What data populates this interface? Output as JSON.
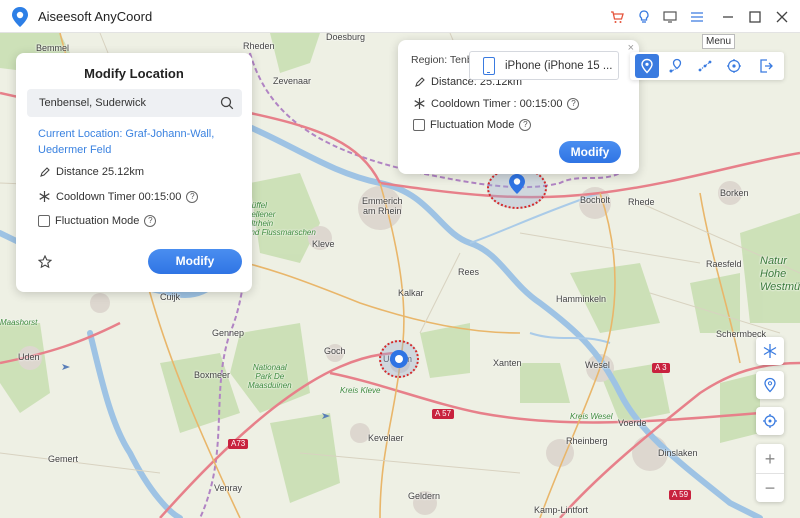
{
  "app": {
    "title": "Aiseesoft AnyCoord",
    "menu_tooltip": "Menu",
    "icons": [
      "cart-icon",
      "hint-icon",
      "screen-icon",
      "menu-icon",
      "minimize-icon",
      "maximize-icon",
      "close-icon"
    ]
  },
  "modify_panel": {
    "title": "Modify Location",
    "search_value": "Tenbensel,  Suderwick",
    "current_location": "Current Location: Graf-Johann-Wall, Uedermer Feld",
    "distance": "Distance 25.12km",
    "cooldown": "Cooldown Timer 00:15:00",
    "fluctuation": "Fluctuation Mode",
    "button": "Modify"
  },
  "popup": {
    "region": "Region: Tenbensel,  Suderwick",
    "distance": "Distance: 25.12km",
    "cooldown": "Cooldown Timer : 00:15:00",
    "fluctuation": "Fluctuation Mode",
    "button": "Modify",
    "close": "×"
  },
  "device": {
    "name": "iPhone (iPhone 15 ..."
  },
  "modes": [
    "modify-location",
    "one-stop-mode",
    "multi-stop-mode",
    "joystick-mode",
    "exit"
  ],
  "side_controls": {
    "zoom_in": "+",
    "zoom_out": "−"
  },
  "map": {
    "places": [
      {
        "name": "Doesburg"
      },
      {
        "name": "Rheden"
      },
      {
        "name": "Bemmel"
      },
      {
        "name": "Zevenaar"
      },
      {
        "name": "Emmerich\nam Rhein"
      },
      {
        "name": "Kleve"
      },
      {
        "name": "Bocholt"
      },
      {
        "name": "Rhede"
      },
      {
        "name": "Borken"
      },
      {
        "name": "Cuijk"
      },
      {
        "name": "Kalkar"
      },
      {
        "name": "Rees"
      },
      {
        "name": "Hamminkeln"
      },
      {
        "name": "Raesfeld"
      },
      {
        "name": "Gennep"
      },
      {
        "name": "Goch"
      },
      {
        "name": "Uedem"
      },
      {
        "name": "Xanten"
      },
      {
        "name": "Wesel"
      },
      {
        "name": "Schermbeck"
      },
      {
        "name": "Uden"
      },
      {
        "name": "Boxmeer"
      },
      {
        "name": "Kevelaer"
      },
      {
        "name": "Voerde"
      },
      {
        "name": "Gemert"
      },
      {
        "name": "Venray"
      },
      {
        "name": "Geldern"
      },
      {
        "name": "Rheinberg"
      },
      {
        "name": "Dinslaken"
      },
      {
        "name": "Kamp-Lintfort"
      },
      {
        "name": "Maashorst"
      }
    ],
    "parks": [
      {
        "name": "Düffel\nKellener\nAltrhein\nund Flussmarschen"
      },
      {
        "name": "Nationaal\nPark De\nMaasduinen"
      },
      {
        "name": "Kreis Kleve"
      },
      {
        "name": "Kreis Wesel"
      }
    ],
    "park_right": "Natur\nHohe\nWestmü",
    "roads": [
      {
        "label": "A 3"
      },
      {
        "label": "A 57"
      },
      {
        "label": "A73"
      },
      {
        "label": "A 59"
      }
    ]
  }
}
